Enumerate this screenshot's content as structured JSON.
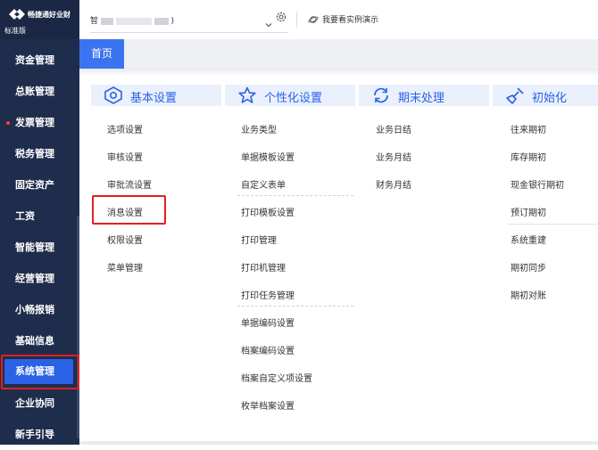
{
  "brand": {
    "name": "畅捷通好业财",
    "edition": "标准版"
  },
  "sidebar": {
    "items": [
      {
        "label": "资金管理"
      },
      {
        "label": "总账管理"
      },
      {
        "label": "发票管理"
      },
      {
        "label": "税务管理"
      },
      {
        "label": "固定资产"
      },
      {
        "label": "工资"
      },
      {
        "label": "智能管理"
      },
      {
        "label": "经营管理"
      },
      {
        "label": "小畅报销"
      },
      {
        "label": "基础信息"
      },
      {
        "label": "系统管理",
        "active": true
      },
      {
        "label": "企业协同"
      },
      {
        "label": "新手引导"
      }
    ]
  },
  "topbar": {
    "account_prefix": "智",
    "account_suffix": ")",
    "demo_label": "我要看实例演示"
  },
  "tabs": [
    {
      "label": "首页",
      "active": true
    }
  ],
  "columns": [
    {
      "title": "基本设置",
      "icon": "gear-icon",
      "items": [
        "选项设置",
        "审核设置",
        "审批流设置",
        "消息设置",
        "权限设置",
        "菜单管理"
      ]
    },
    {
      "title": "个性化设置",
      "icon": "star-icon",
      "items": [
        "业务类型",
        "单据模板设置",
        "自定义表单",
        "打印模板设置",
        "打印管理",
        "打印机管理",
        "打印任务管理",
        "单据编码设置",
        "档案编码设置",
        "档案自定义项设置",
        "枚举档案设置"
      ]
    },
    {
      "title": "期末处理",
      "icon": "refresh-icon",
      "items": [
        "业务日结",
        "业务月结",
        "财务月结"
      ]
    },
    {
      "title": "初始化",
      "icon": "broom-icon",
      "items": [
        "往来期初",
        "库存期初",
        "现金银行期初",
        "预订期初",
        "系统重建",
        "期初同步",
        "期初对账"
      ]
    }
  ],
  "colors": {
    "sidebar": "#1f2d4d",
    "accent": "#2a62e6",
    "highlight": "#e02020"
  }
}
